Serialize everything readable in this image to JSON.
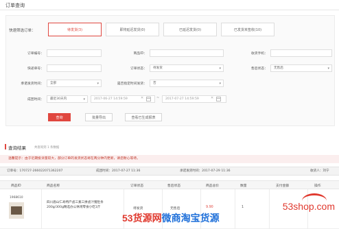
{
  "page": {
    "title": "订单查询"
  },
  "quick_filter": {
    "label": "快速筛选订单：",
    "buttons": [
      "待发货(3)",
      "即将延迟发货(0)",
      "已延迟发货(0)",
      "已发货未签收(10)"
    ]
  },
  "fields": {
    "order_no": "订单编号：",
    "product_id": "商品ID：",
    "phone": "收货手机：",
    "tracking_no": "快递单号：",
    "order_status": {
      "label": "订单状态：",
      "value": "待发货"
    },
    "shop_status": {
      "label": "售后状态：",
      "value": "无售后"
    },
    "agreed_ship": {
      "label": "承诺发货时间：",
      "value": "全部"
    },
    "is_presale": {
      "label": "是否指定时间发货：",
      "value": "否"
    },
    "deal_time": {
      "label": "成团时间：",
      "range": "最近30天内",
      "start": "2017-06-27 14:59:59",
      "end": "2017-07-27 14:59:59"
    }
  },
  "actions": {
    "query": "查询",
    "batch_export": "批量导出",
    "view_exported": "查看已生成报表"
  },
  "results": {
    "title": "查询结果",
    "subtitle": "共查询到 1 条数据",
    "tip": "温馨提示：由于近期投诉量较大，部分订单的发货状态将在两分钟内更新，请您耐心等待。",
    "order_header": {
      "order_no": "订单号：170727-266022071362207",
      "deal_time": "成团时间：2017-07-27 11:36",
      "ship_deadline": "承诺发货时间：2017-07-29 11:36",
      "receiver": "收货人：刘宁"
    },
    "columns": [
      "商品ID",
      "商品名称",
      "订单状态",
      "售后状态",
      "商品总价",
      "数量",
      "支付金额",
      "操作"
    ],
    "row": {
      "product_id": "1968610",
      "product_name": "四川眉山仁寿特产卤三素三拼卤汁猪肚条 200g/300g精选办公休闲零食小吃1斤",
      "order_status": "待发货",
      "after_sale": "无售后",
      "total_price": "9.90",
      "quantity": "1"
    }
  },
  "watermark": {
    "site": "53shop.com",
    "bar_prefix": "53货源网",
    "bar_suffix": "微商淘宝货源"
  }
}
